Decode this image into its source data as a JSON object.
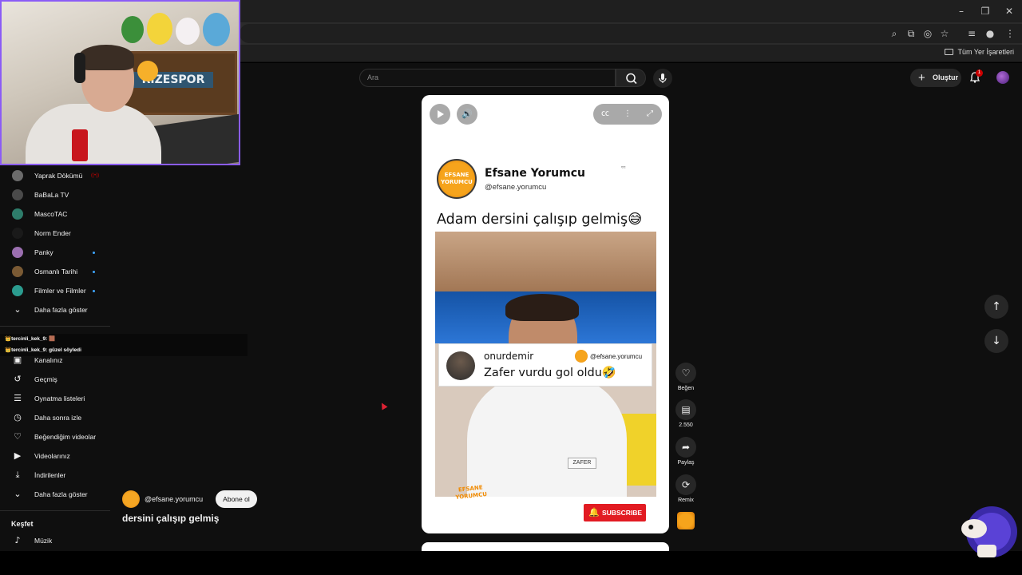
{
  "browser": {
    "bookmarks_all_label": "Tüm Yer İşaretleri"
  },
  "header": {
    "search_placeholder": "Ara",
    "create_label": "Oluştur",
    "notification_count": "1"
  },
  "sidebar": {
    "subscriptions": [
      {
        "label": "Yaprak Dökümü",
        "avatar_color": "#6b6b6b",
        "indicator": "live"
      },
      {
        "label": "BaBaLa TV",
        "avatar_color": "#4a4a4a",
        "indicator": ""
      },
      {
        "label": "MascoTAC",
        "avatar_color": "#2e7d6b",
        "indicator": ""
      },
      {
        "label": "Norm Ender",
        "avatar_color": "#1a1a1a",
        "indicator": ""
      },
      {
        "label": "Panky",
        "avatar_color": "#9b6fb0",
        "indicator": "new"
      },
      {
        "label": "Osmanlı Tarihi",
        "avatar_color": "#7a5a34",
        "indicator": "new"
      },
      {
        "label": "Filmler ve Filmler",
        "avatar_color": "#2b9c8f",
        "indicator": "new"
      }
    ],
    "show_more_1": "Daha fazla göster",
    "you_items": [
      {
        "label": "Kanalınız",
        "icon": "channel-icon"
      },
      {
        "label": "Geçmiş",
        "icon": "history-icon"
      },
      {
        "label": "Oynatma listeleri",
        "icon": "playlists-icon"
      },
      {
        "label": "Daha sonra izle",
        "icon": "watch-later-icon"
      },
      {
        "label": "Beğendiğim videolar",
        "icon": "liked-icon"
      },
      {
        "label": "Videolarınız",
        "icon": "your-videos-icon"
      },
      {
        "label": "İndirilenler",
        "icon": "downloads-icon"
      }
    ],
    "show_more_2": "Daha fazla göster",
    "explore_heading": "Keşfet",
    "explore_items": [
      {
        "label": "Müzik",
        "icon": "music-icon"
      }
    ]
  },
  "chat": {
    "lines": [
      "👑tercinli_kek_9: 🟫",
      "👑tercinli_kek_9: güzel söyledi"
    ]
  },
  "webcam": {
    "shelf_sign": "RIZESPOR"
  },
  "short": {
    "channel_handle": "@efsane.yorumcu",
    "subscribe_label": "Abone ol",
    "title": "dersini çalışıp gelmiş"
  },
  "player": {
    "logo_text": "EFSANE YORUMCU",
    "channel_name": "Efsane Yorumcu",
    "channel_handle": "@efsane.yorumcu",
    "caption": "Adam dersini çalışıp gelmiş😅",
    "comment_user": "onurdemir",
    "comment_handle": "@efsane.yorumcu",
    "comment_text": "Zafer vurdu gol oldu🤣",
    "name_tag": "ZAFER",
    "watermark": "EFSANE YORUMCU",
    "subscribe_label": "SUBSCRIBE"
  },
  "actions": {
    "like_label": "Beğen",
    "comments_count": "2.550",
    "share_label": "Paylaş",
    "remix_label": "Remix"
  },
  "colors": {
    "accent_red": "#cc0000",
    "stream_border": "#8b5cf6",
    "brand_orange": "#f6a41c"
  }
}
